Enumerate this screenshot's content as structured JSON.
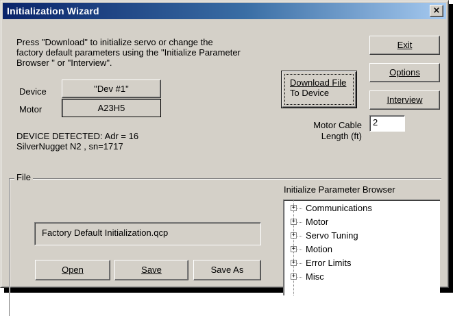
{
  "window": {
    "title": "Initialization Wizard",
    "close_glyph": "×"
  },
  "instructions": {
    "line1": "Press \"Download\" to initialize servo or change the",
    "line2": "factory default parameters using the \"Initialize Parameter",
    "line3": "Browser \" or \"Interview\"."
  },
  "device": {
    "device_label": "Device",
    "device_value": "\"Dev #1\"",
    "motor_label": "Motor",
    "motor_value": "A23H5",
    "detected_line1": "DEVICE DETECTED: Adr = 16",
    "detected_line2": "SilverNugget N2 , sn=1717"
  },
  "buttons": {
    "download_line1": "Download File",
    "download_line2": "To Device",
    "exit": "Exit",
    "options": "Options",
    "interview": "Interview",
    "open": "Open",
    "save": "Save",
    "save_as": "Save As"
  },
  "motor_cable": {
    "label_line1": "Motor Cable",
    "label_line2": "Length (ft)",
    "value": "2"
  },
  "file": {
    "group_label": "File",
    "filename": "Factory Default Initialization.qcp"
  },
  "parameter_browser": {
    "label": "Initialize Parameter Browser",
    "items": [
      "Communications",
      "Motor",
      "Servo Tuning",
      "Motion",
      "Error Limits",
      "Misc"
    ]
  },
  "icons": {
    "close": "close-icon",
    "expander": "plus-expander-icon"
  },
  "colors": {
    "titlebar_start": "#0a246a",
    "titlebar_end": "#a6caf0",
    "face": "#d4d0c8"
  }
}
